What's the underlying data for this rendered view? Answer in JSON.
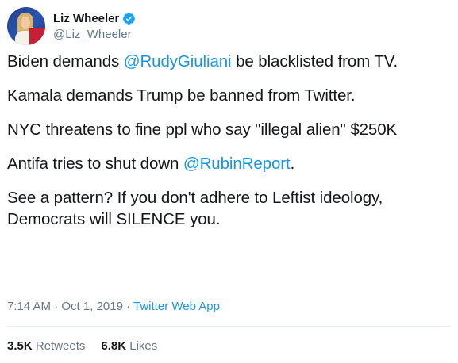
{
  "author": {
    "display_name": "Liz Wheeler",
    "handle": "@Liz_Wheeler",
    "verified_icon": "verified-badge-icon"
  },
  "tweet": {
    "lines": [
      {
        "before": "Biden demands ",
        "mention": "@RudyGiuliani",
        "after": " be blacklisted from TV."
      },
      {
        "before": "Kamala demands Trump be banned from Twitter.",
        "mention": "",
        "after": ""
      },
      {
        "before": "NYC threatens to fine ppl who say \"illegal alien\" $250K",
        "mention": "",
        "after": ""
      },
      {
        "before": "Antifa tries to shut down ",
        "mention": "@RubinReport",
        "after": "."
      },
      {
        "before": "See a pattern? If you don't adhere to Leftist ideology,",
        "mention": "",
        "after": ""
      }
    ],
    "last_line": "Democrats will SILENCE you."
  },
  "meta": {
    "time": "7:14 AM",
    "sep1": " · ",
    "date": "Oct 1, 2019",
    "sep2": " · ",
    "source": "Twitter Web App"
  },
  "stats": {
    "retweets_count": "3.5K",
    "retweets_label": "Retweets",
    "likes_count": "6.8K",
    "likes_label": "Likes"
  },
  "colors": {
    "link": "#1b95e0",
    "text": "#14171a",
    "muted": "#657786"
  }
}
